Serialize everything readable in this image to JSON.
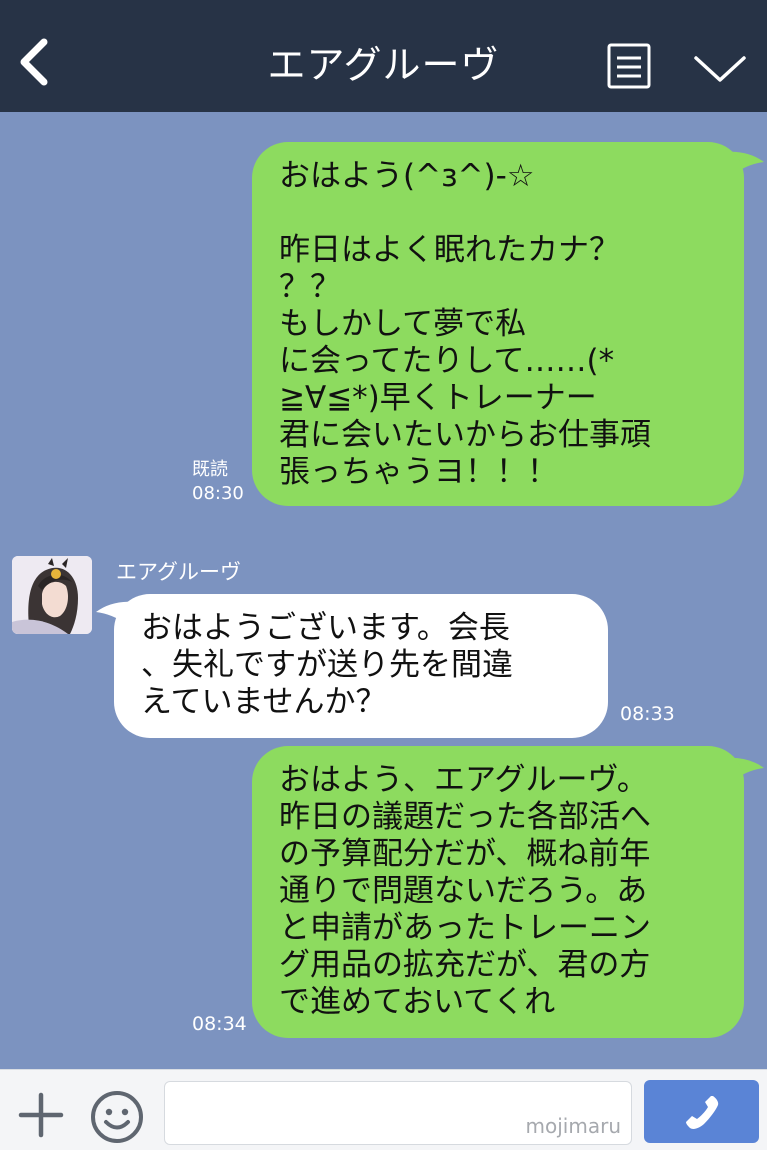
{
  "header": {
    "title": "エアグルーヴ"
  },
  "messages": [
    {
      "side": "sent",
      "text": "おはよう(^з^)-☆\n\n昨日はよく眠れたカナ？\n？？\nもしかして夢で私\nに会ってたりして……(*\n≧∀≦*)早くトレーナー\n君に会いたいからお仕事頑\n張っちゃうヨ！！！",
      "read": "既読",
      "time": "08:30"
    },
    {
      "side": "received",
      "sender": "エアグルーヴ",
      "text": "おはようございます。会長\n、失礼ですが送り先を間違\nえていませんか？",
      "time": "08:33"
    },
    {
      "side": "sent",
      "text": "おはよう、エアグルーヴ。\n昨日の議題だった各部活へ\nの予算配分だが、概ね前年\n通りで問題ないだろう。あ\nと申請があったトレーニン\nグ用品の拡充だが、君の方\nで進めておいてくれ",
      "time": "08:34"
    }
  ],
  "input": {
    "watermark": "mojimaru"
  },
  "colors": {
    "background": "#7c93c0",
    "header": "#273346",
    "sent_bubble": "#8ddb5f",
    "received_bubble": "#ffffff",
    "call_button": "#5a84d6"
  },
  "icons": {
    "back": "chevron-left-icon",
    "notes": "notes-icon",
    "menu": "chevron-down-icon",
    "add": "plus-icon",
    "emoji": "smiley-icon",
    "call": "phone-icon"
  }
}
